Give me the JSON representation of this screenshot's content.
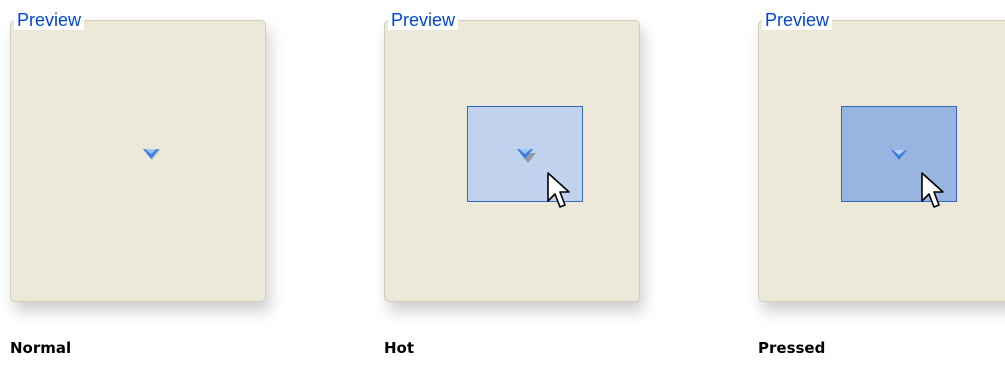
{
  "preview_panels": [
    {
      "legend": "Preview",
      "state_label": "Normal",
      "button_state": "normal"
    },
    {
      "legend": "Preview",
      "state_label": "Hot",
      "button_state": "hot"
    },
    {
      "legend": "Preview",
      "state_label": "Pressed",
      "button_state": "pressed"
    }
  ],
  "icons": {
    "dropdown_arrow": "chevron-down-icon",
    "cursor": "mouse-pointer-icon"
  },
  "colors": {
    "legend_text": "#0046d5",
    "group_background": "#ece9d8",
    "hot_fill": "#c1d2ee",
    "pressed_fill": "#98b5e2",
    "highlight_border": "#316ac5"
  }
}
